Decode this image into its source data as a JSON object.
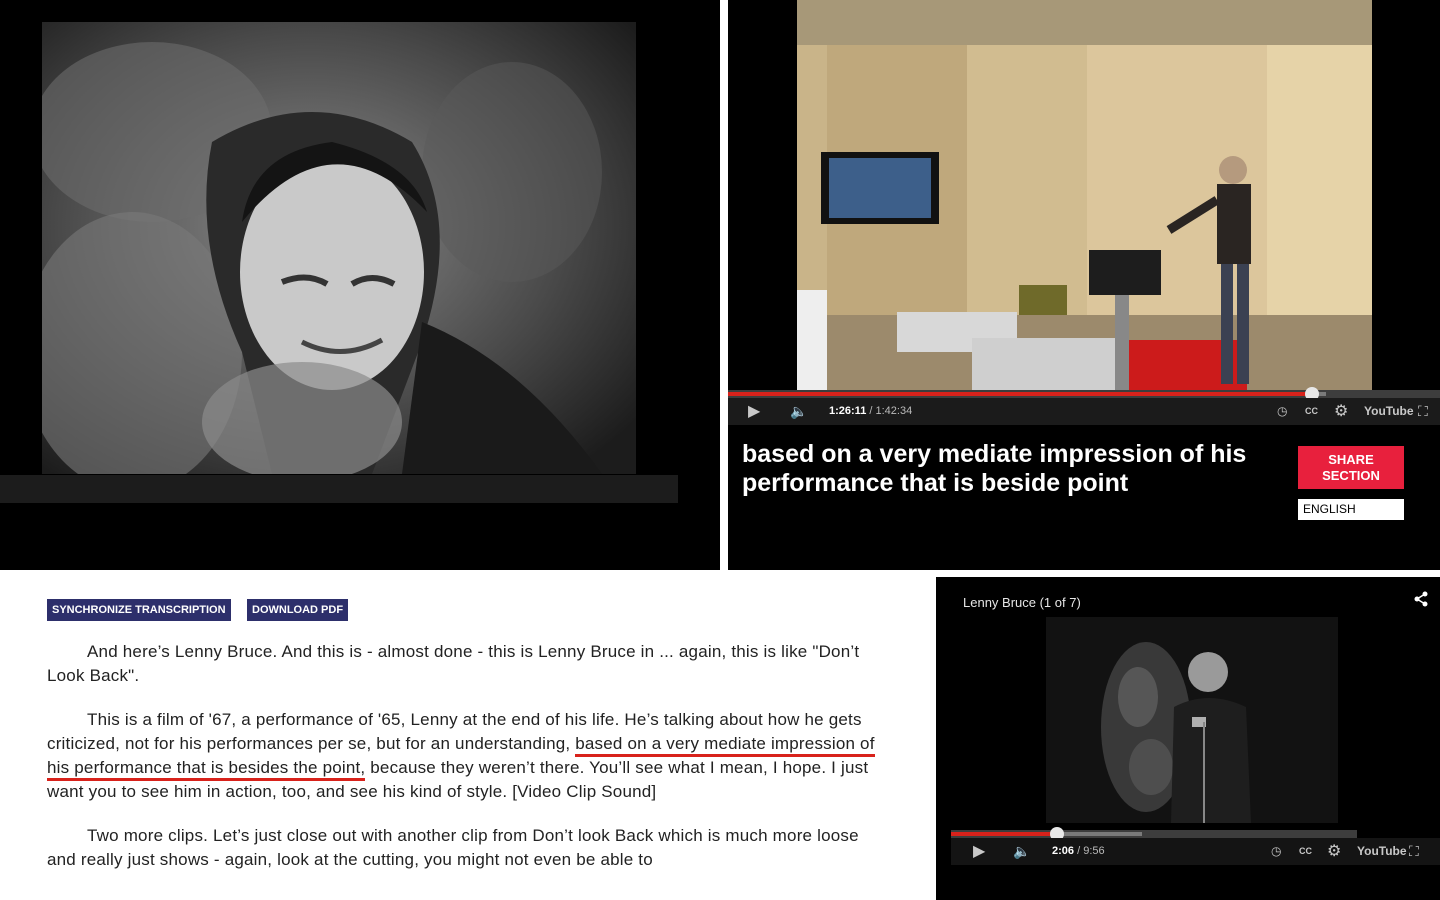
{
  "lecture_player": {
    "elapsed": "1:26:11",
    "duration": "/ 1:42:34",
    "progress": 0.82,
    "buffered": 0.84,
    "subtitle": "based on a very mediate impression of his performance that is beside point",
    "share_label": "SHARE\nSECTION",
    "language": "ENGLISH",
    "cc_label": "CC",
    "youtube_label": "YouTube"
  },
  "transcript": {
    "sync_label": "SYNCHRONIZE TRANSCRIPTION",
    "pdf_label": "DOWNLOAD PDF",
    "p1": "And here’s Lenny Bruce. And this is - almost done - this is Lenny Bruce in ... again, this is like \"Don’t Look Back\".",
    "p2_before": "This is a film of '67, a performance of '65, Lenny at the end of his life. He’s talking about how he gets criticized, not for his performances per se, but for an understanding, ",
    "p2_highlight": "based on a very mediate impression of his performance that is besides the point,",
    "p2_after": " because they weren’t there. You’ll see what I mean, I hope. I just want you to see him in action, too, and see his kind of style. [Video Clip Sound]",
    "p3": "Two more clips. Let’s just close out with another clip from Don’t look Back which is much more loose and really just shows - again, look at the cutting, you might not even be able to"
  },
  "embed_player": {
    "title": "Lenny Bruce (1 of 7)",
    "elapsed": "2:06",
    "duration": "/ 9:56",
    "progress": 0.26,
    "buffered": 0.47,
    "cc_label": "CC",
    "youtube_label": "YouTube"
  }
}
